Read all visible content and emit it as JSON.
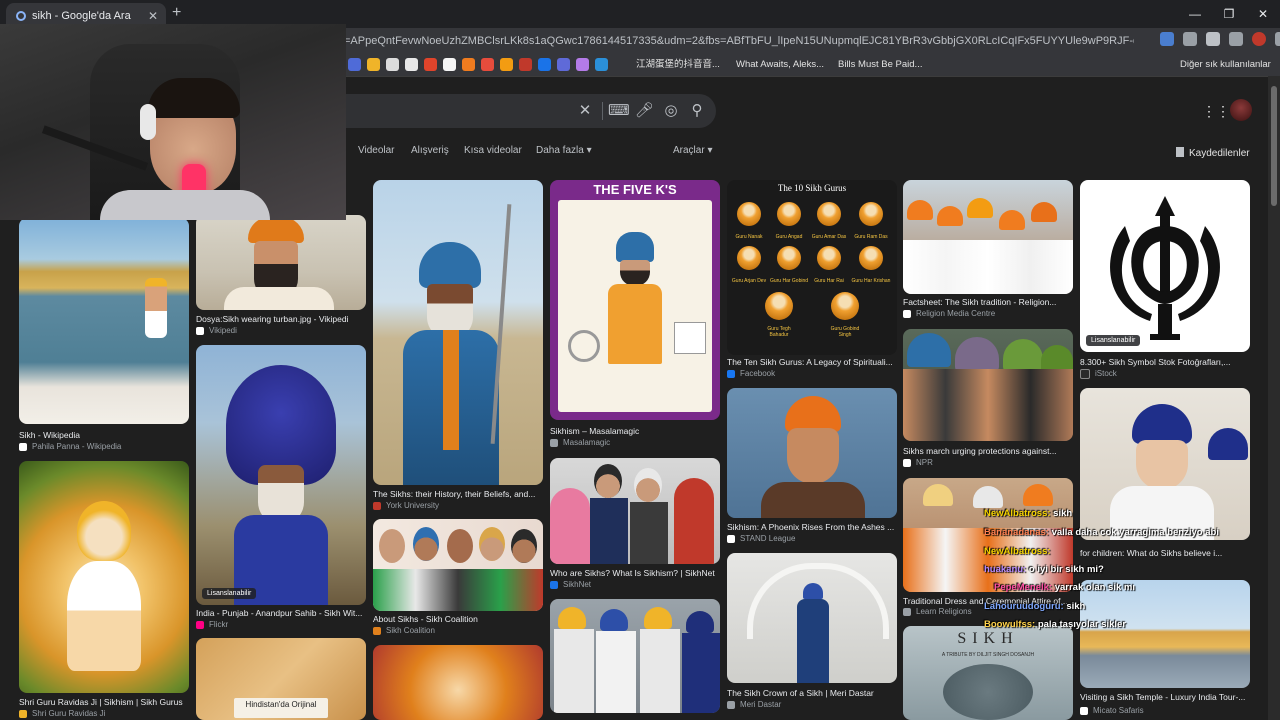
{
  "window": {
    "tab_title": "sikh - Google'da Ara",
    "tab_close": "✕",
    "new_tab": "+",
    "minimize": "—",
    "maximize": "❐",
    "close": "✕"
  },
  "address": {
    "url": "=APpeQntFevwNoeUzhZMBClsrLKk8s1aQGwc1786144517335&udm=2&fbs=ABfTbFU_lIpeN15UNupmqlEJC81YBrR3vGbbjGX0RLcICqIFx5FUYYUle9wP9RJF-qVSmfIXgYMx-NuKPqWXvqz_tlH..."
  },
  "bookmarks": {
    "chinese": "江湖蛋堡的抖音音...",
    "what_awaits": "What Awaits, Aleks...",
    "bills": "Bills Must Be Paid...",
    "other": "Diğer sık kullanılanlar"
  },
  "filters": {
    "videos": "Videolar",
    "shopping": "Alışveriş",
    "short_videos": "Kısa videolar",
    "more": "Daha fazla",
    "tools": "Araçlar",
    "saved": "Kaydedilenler"
  },
  "badge_text": "Lisanslanabilir",
  "posters": {
    "five_ks": "THE FIVE K'S",
    "ten_gurus": "The 10 Sikh Gurus",
    "guru_names": [
      "Guru Nanak",
      "Guru Angad",
      "Guru Amar Das",
      "Guru Ram Das",
      "Guru Arjan Dev",
      "Guru Har Gobind",
      "Guru Har Rai",
      "Guru Har Krishan",
      "Guru Tegh Bahadur",
      "Guru Gobind Singh"
    ],
    "sikh_cover": "SIKH",
    "sikh_cover_sub": "A TRIBUTE BY DILJIT SINGH DOSANJH",
    "hindistan": "Hindistan'da Orijinal"
  },
  "results": [
    {
      "caption": "Sikh - Wikipedia",
      "source": "Pahila Panna - Wikipedia"
    },
    {
      "caption": "Shri Guru Ravidas Ji | Sikhism | Sikh Gurus",
      "source": "Shri Guru Ravidas Ji"
    },
    {
      "caption": "Dosya:Sikh wearing turban.jpg - Vikipedi",
      "source": "Vikipedi"
    },
    {
      "caption": "India - Punjab - Anandpur Sahib - Sikh Wit...",
      "source": "Flickr"
    },
    {
      "caption": "The Sikhs: their History, their Beliefs, and...",
      "source": "York University"
    },
    {
      "caption": "About Sikhs - Sikh Coalition",
      "source": "Sikh Coalition"
    },
    {
      "caption": "Sikhism – Masalamagic",
      "source": "Masalamagic"
    },
    {
      "caption": "Who are Sikhs? What Is Sikhism? | SikhNet",
      "source": "SikhNet"
    },
    {
      "caption": "The Ten Sikh Gurus: A Legacy of Spirituali...",
      "source": "Facebook"
    },
    {
      "caption": "Sikhism: A Phoenix Rises From the Ashes ...",
      "source": "STAND League"
    },
    {
      "caption": "The Sikh Crown of a Sikh | Meri Dastar",
      "source": "Meri Dastar"
    },
    {
      "caption": "Factsheet: The Sikh tradition - Religion...",
      "source": "Religion Media Centre"
    },
    {
      "caption": "Sikhs march urging protections against...",
      "source": "NPR"
    },
    {
      "caption": "Traditional Dress and Ceremonial Attire of...",
      "source": "Learn Religions"
    },
    {
      "caption": "8.300+ Sikh Symbol Stok Fotoğrafları,...",
      "source": "iStock"
    },
    {
      "caption": "for children: What do Sikhs believe i...",
      "source": ""
    },
    {
      "caption": "Visiting a Sikh Temple - Luxury India Tour-...",
      "source": "Micato Safaris"
    }
  ],
  "chat": [
    {
      "user": "NewAlbatross:",
      "text": " sikh",
      "color": "#f5d300"
    },
    {
      "user": "Bananadanas:",
      "text": " valla daha cok yarragima benziyo abi",
      "color": "#ff7f50"
    },
    {
      "user": "NewAlbatross:",
      "text": "",
      "color": "#f5d300"
    },
    {
      "user": "huakanu:",
      "text": " o iyi bir sikh mi?",
      "color": "#b388ff"
    },
    {
      "user": "PepeMenelk:",
      "text": " yarrak olan sik mı",
      "color": "#ff4fa3"
    },
    {
      "user": "Lahouruudoguru:",
      "text": " sikh",
      "color": "#7fa8ff"
    },
    {
      "user": "Boowulfss:",
      "text": " pala taşıyolar sikler",
      "color": "#ffd24a"
    }
  ],
  "colors": {
    "accent": "#8ab4f8",
    "page_bg": "#1f1f1f"
  }
}
